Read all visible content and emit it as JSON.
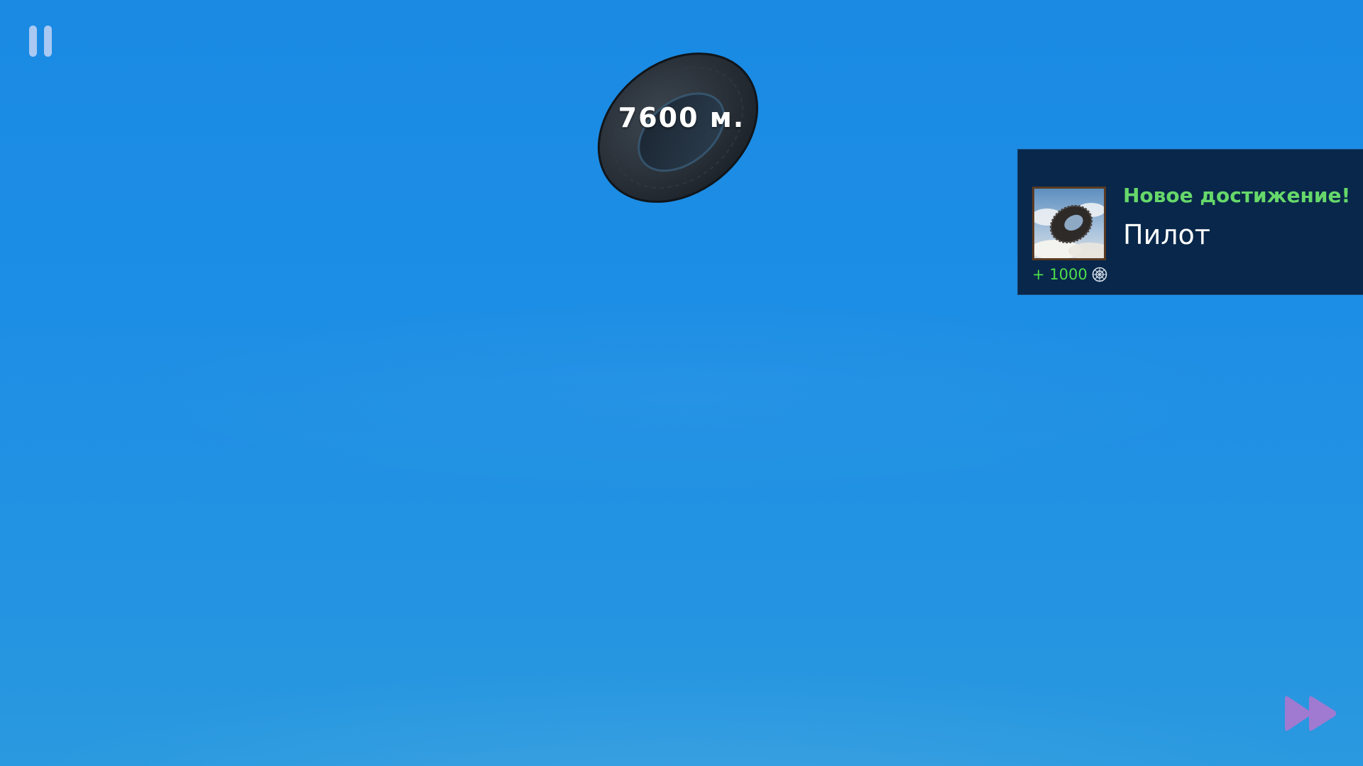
{
  "hud": {
    "distance": "7600 м.",
    "pause_icon": "pause-icon",
    "fast_forward_icon": "fast-forward-icon"
  },
  "achievement": {
    "heading": "Новое достижение!",
    "name": "Пилот",
    "reward": "+ 1000",
    "reward_icon": "coin-icon"
  },
  "colors": {
    "sky": "#1d8ee5",
    "panel_bg": "#08274a",
    "heading_green": "#66d86a",
    "reward_green": "#4ede4e",
    "pause_icon": "#a9c9f2",
    "fast_forward": "#a07ad0"
  }
}
